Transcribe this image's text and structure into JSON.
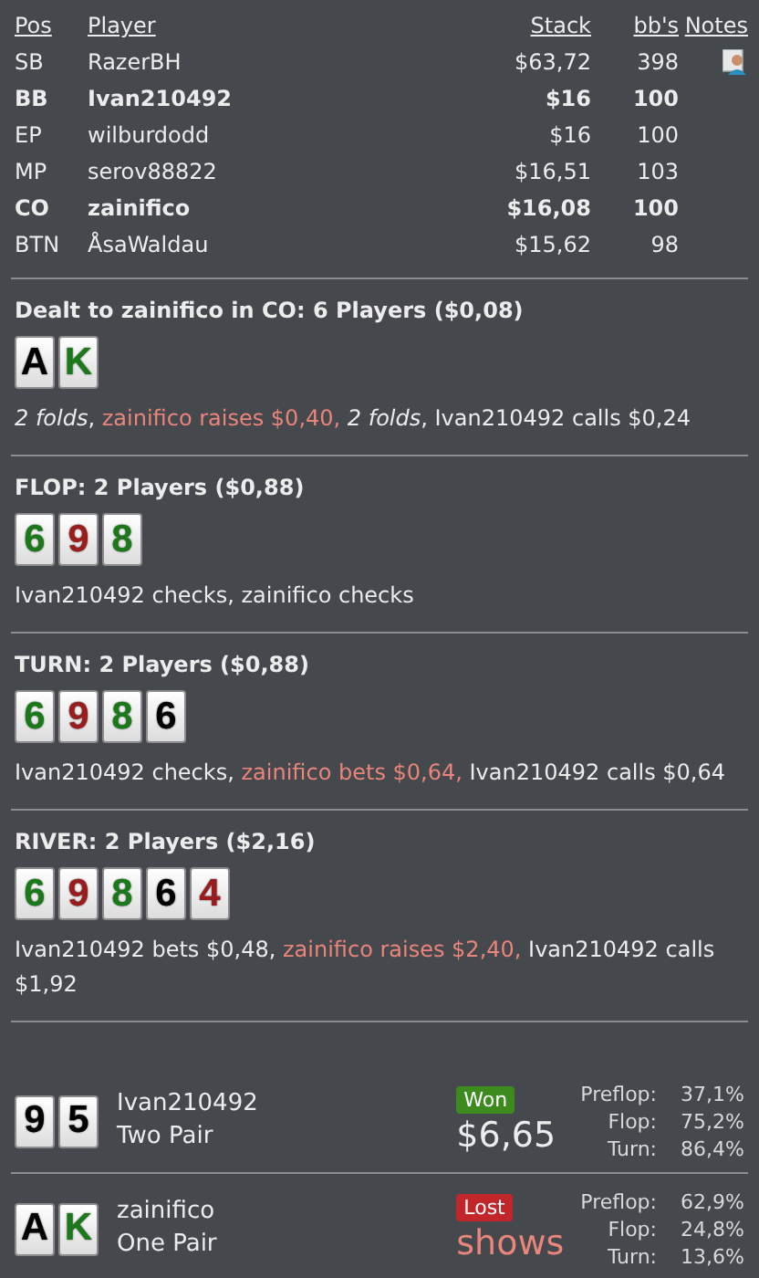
{
  "players_table": {
    "columns": [
      "Pos",
      "Player",
      "Stack",
      "bb's",
      "Notes"
    ],
    "rows": [
      {
        "pos": "SB",
        "player": "RazerBH",
        "stack": "$63,72",
        "bbs": "398",
        "bold": false,
        "has_note": true
      },
      {
        "pos": "BB",
        "player": "Ivan210492",
        "stack": "$16",
        "bbs": "100",
        "bold": true,
        "has_note": false
      },
      {
        "pos": "EP",
        "player": "wilburdodd",
        "stack": "$16",
        "bbs": "100",
        "bold": false,
        "has_note": false
      },
      {
        "pos": "MP",
        "player": "serov88822",
        "stack": "$16,51",
        "bbs": "103",
        "bold": false,
        "has_note": false
      },
      {
        "pos": "CO",
        "player": "zainifico",
        "stack": "$16,08",
        "bbs": "100",
        "bold": true,
        "has_note": false
      },
      {
        "pos": "BTN",
        "player": "ÅsaWaldau",
        "stack": "$15,62",
        "bbs": "98",
        "bold": false,
        "has_note": false
      }
    ]
  },
  "streets": [
    {
      "title": "Dealt to zainifico in CO: 6 Players ($0,08)",
      "cards": [
        {
          "rank": "A",
          "color": "#000000"
        },
        {
          "rank": "K",
          "color": "#1a7a1a"
        }
      ],
      "actions": [
        {
          "text": "*2 folds*, ",
          "kind": "plain"
        },
        {
          "text": "zainifico raises $0,40, ",
          "kind": "hero"
        },
        {
          "text": "*2 folds*, Ivan210492 calls $0,24",
          "kind": "plain"
        }
      ]
    },
    {
      "title": "FLOP: 2 Players ($0,88)",
      "cards": [
        {
          "rank": "6",
          "color": "#1a7a1a"
        },
        {
          "rank": "9",
          "color": "#9a1c1c"
        },
        {
          "rank": "8",
          "color": "#1a7a1a"
        }
      ],
      "actions": [
        {
          "text": "Ivan210492 checks, zainifico checks",
          "kind": "plain"
        }
      ]
    },
    {
      "title": "TURN: 2 Players ($0,88)",
      "cards": [
        {
          "rank": "6",
          "color": "#1a7a1a"
        },
        {
          "rank": "9",
          "color": "#9a1c1c"
        },
        {
          "rank": "8",
          "color": "#1a7a1a"
        },
        {
          "rank": "6",
          "color": "#000000"
        }
      ],
      "actions": [
        {
          "text": "Ivan210492 checks, ",
          "kind": "plain"
        },
        {
          "text": "zainifico bets $0,64, ",
          "kind": "hero"
        },
        {
          "text": "Ivan210492 calls $0,64",
          "kind": "plain"
        }
      ]
    },
    {
      "title": "RIVER: 2 Players ($2,16)",
      "cards": [
        {
          "rank": "6",
          "color": "#1a7a1a"
        },
        {
          "rank": "9",
          "color": "#9a1c1c"
        },
        {
          "rank": "8",
          "color": "#1a7a1a"
        },
        {
          "rank": "6",
          "color": "#000000"
        },
        {
          "rank": "4",
          "color": "#9a1c1c"
        }
      ],
      "actions": [
        {
          "text": "Ivan210492 bets $0,48, ",
          "kind": "plain"
        },
        {
          "text": "zainifico raises $2,40, ",
          "kind": "hero"
        },
        {
          "text": "Ivan210492 calls $1,92",
          "kind": "plain"
        }
      ]
    }
  ],
  "results": [
    {
      "cards": [
        {
          "rank": "9",
          "color": "#000000"
        },
        {
          "rank": "5",
          "color": "#000000"
        }
      ],
      "player": "Ivan210492",
      "hand": "Two Pair",
      "outcome": "Won",
      "amount": "$6,65",
      "equity": [
        {
          "label": "Preflop:",
          "value": "37,1%"
        },
        {
          "label": "Flop:",
          "value": "75,2%"
        },
        {
          "label": "Turn:",
          "value": "86,4%"
        }
      ]
    },
    {
      "cards": [
        {
          "rank": "A",
          "color": "#000000"
        },
        {
          "rank": "K",
          "color": "#1a7a1a"
        }
      ],
      "player": "zainifico",
      "hand": "One Pair",
      "outcome": "Lost",
      "amount": "shows",
      "equity": [
        {
          "label": "Preflop:",
          "value": "62,9%"
        },
        {
          "label": "Flop:",
          "value": "24,8%"
        },
        {
          "label": "Turn:",
          "value": "13,6%"
        }
      ]
    }
  ]
}
